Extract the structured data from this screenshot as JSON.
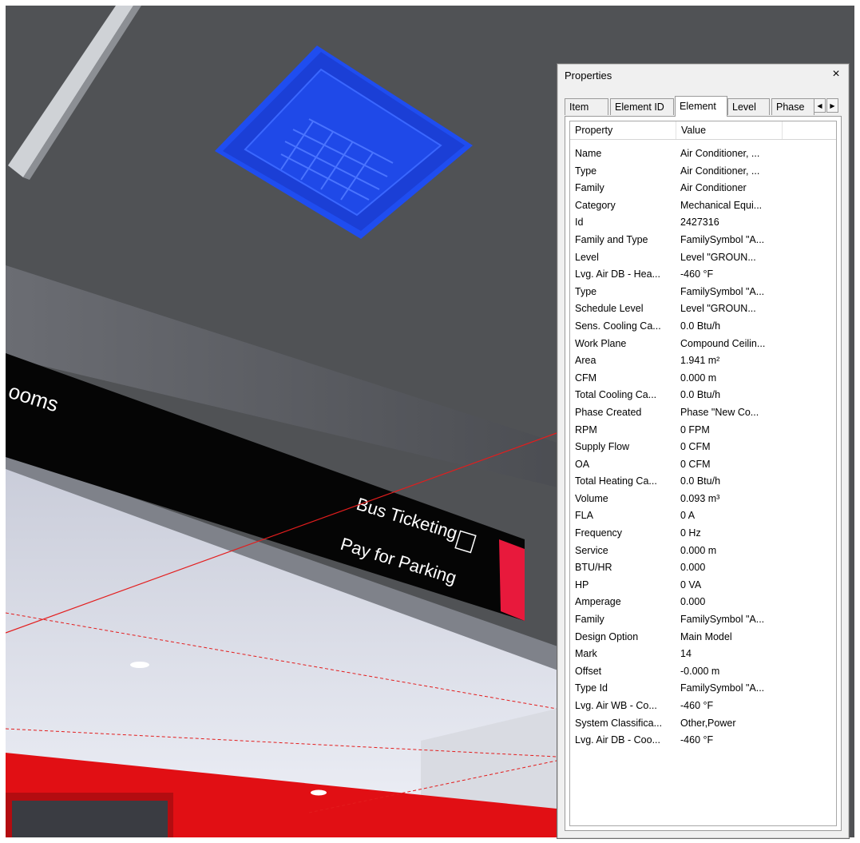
{
  "scene": {
    "sign_left_text": "ooms",
    "sign_right_line1": "Bus Ticketing",
    "sign_right_line2": "Pay for Parking",
    "accent_red": "#e8193c",
    "ceiling_unit_color": "#1447e6"
  },
  "properties_window": {
    "title": "Properties",
    "close_glyph": "×",
    "tabs": [
      "Item",
      "Element ID",
      "Element",
      "Level",
      "Phase"
    ],
    "active_tab": "Element",
    "columns": [
      "Property",
      "Value"
    ],
    "rows": [
      {
        "property": "Name",
        "value": "Air Conditioner, ..."
      },
      {
        "property": "Type",
        "value": "Air Conditioner, ..."
      },
      {
        "property": "Family",
        "value": "Air Conditioner"
      },
      {
        "property": "Category",
        "value": "Mechanical Equi..."
      },
      {
        "property": "Id",
        "value": "2427316"
      },
      {
        "property": "Family and Type",
        "value": "FamilySymbol \"A..."
      },
      {
        "property": "Level",
        "value": "Level \"GROUN..."
      },
      {
        "property": "Lvg. Air DB - Hea...",
        "value": "-460 °F"
      },
      {
        "property": "Type",
        "value": "FamilySymbol \"A..."
      },
      {
        "property": "Schedule Level",
        "value": "Level \"GROUN..."
      },
      {
        "property": "Sens. Cooling Ca...",
        "value": "0.0 Btu/h"
      },
      {
        "property": "Work Plane",
        "value": "Compound Ceilin..."
      },
      {
        "property": "Area",
        "value": "1.941 m²"
      },
      {
        "property": "CFM",
        "value": "0.000 m"
      },
      {
        "property": "Total Cooling Ca...",
        "value": "0.0 Btu/h"
      },
      {
        "property": "Phase Created",
        "value": "Phase \"New Co..."
      },
      {
        "property": "RPM",
        "value": "0 FPM"
      },
      {
        "property": "Supply Flow",
        "value": "0 CFM"
      },
      {
        "property": "OA",
        "value": "0 CFM"
      },
      {
        "property": "Total Heating Ca...",
        "value": "0.0 Btu/h"
      },
      {
        "property": "Volume",
        "value": "0.093 m³"
      },
      {
        "property": "FLA",
        "value": "0 A"
      },
      {
        "property": "Frequency",
        "value": "0 Hz"
      },
      {
        "property": "Service",
        "value": "0.000 m"
      },
      {
        "property": "BTU/HR",
        "value": "0.000"
      },
      {
        "property": "HP",
        "value": "0 VA"
      },
      {
        "property": "Amperage",
        "value": "0.000"
      },
      {
        "property": "Family",
        "value": "FamilySymbol \"A..."
      },
      {
        "property": "Design Option",
        "value": "Main Model"
      },
      {
        "property": "Mark",
        "value": "14"
      },
      {
        "property": "Offset",
        "value": "-0.000 m"
      },
      {
        "property": "Type Id",
        "value": "FamilySymbol \"A..."
      },
      {
        "property": "Lvg. Air WB - Co...",
        "value": "-460 °F"
      },
      {
        "property": "System Classifica...",
        "value": "Other,Power"
      },
      {
        "property": "Lvg. Air DB - Coo...",
        "value": "-460 °F"
      }
    ]
  }
}
